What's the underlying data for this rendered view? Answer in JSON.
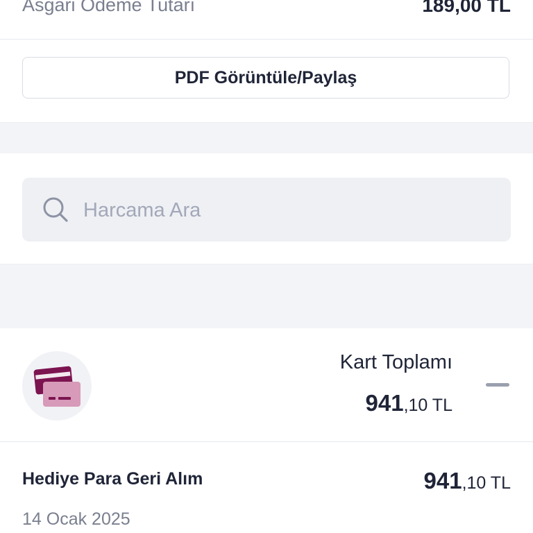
{
  "summary": {
    "min_payment_label": "Asgari Ödeme Tutarı",
    "min_payment_value": "189,00 TL"
  },
  "actions": {
    "pdf_button_label": "PDF Görüntüle/Paylaş"
  },
  "search": {
    "placeholder": "Harcama Ara",
    "value": "",
    "icon": "search-icon"
  },
  "card_total": {
    "icon": "card-icon",
    "label": "Kart Toplamı",
    "amount_integer": "941",
    "amount_rest": ",10 TL",
    "toggle_icon": "collapse-icon"
  },
  "transactions": [
    {
      "title": "Hediye Para Geri Alım",
      "amount_integer": "941",
      "amount_rest": ",10 TL",
      "date": "14 Ocak 2025"
    }
  ],
  "colors": {
    "text_primary": "#1f2437",
    "text_secondary": "#7a7f8f",
    "card_icon_dark": "#7c1450",
    "card_icon_light": "#d79ab9",
    "section_gap": "#f3f4f7"
  }
}
